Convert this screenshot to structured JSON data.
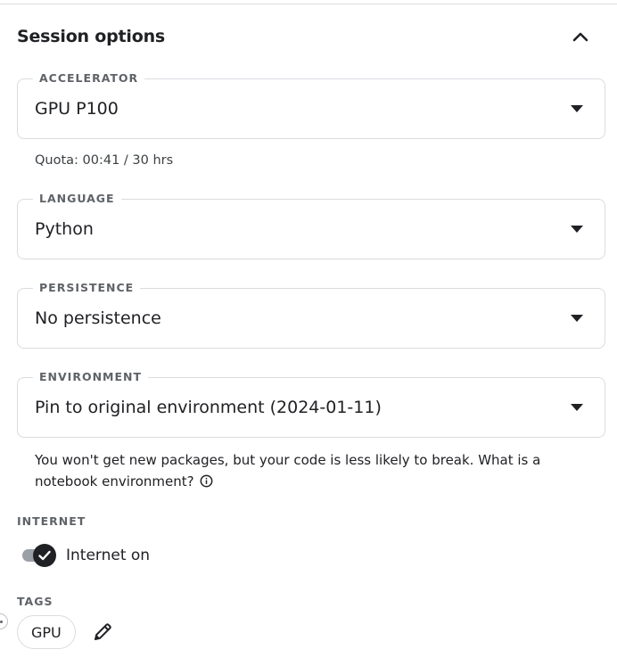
{
  "header": {
    "title": "Session options",
    "collapse_icon": "chevron-up-icon"
  },
  "accelerator": {
    "label": "ACCELERATOR",
    "value": "GPU P100",
    "quota": "Quota: 00:41 / 30 hrs"
  },
  "language": {
    "label": "LANGUAGE",
    "value": "Python"
  },
  "persistence": {
    "label": "PERSISTENCE",
    "value": "No persistence"
  },
  "environment": {
    "label": "ENVIRONMENT",
    "value": "Pin to original environment (2024-01-11)",
    "helper": "You won't get new packages, but your code is less likely to break. What is a notebook environment?"
  },
  "internet": {
    "label": "INTERNET",
    "toggle_label": "Internet on",
    "enabled": true
  },
  "tags": {
    "label": "TAGS",
    "items": [
      "GPU"
    ],
    "edit_icon": "pencil-icon"
  },
  "colors": {
    "text": "#202124",
    "border": "#dadce0",
    "label": "#5f6368",
    "toggle_thumb": "#202124",
    "toggle_track": "#9aa0a6"
  }
}
